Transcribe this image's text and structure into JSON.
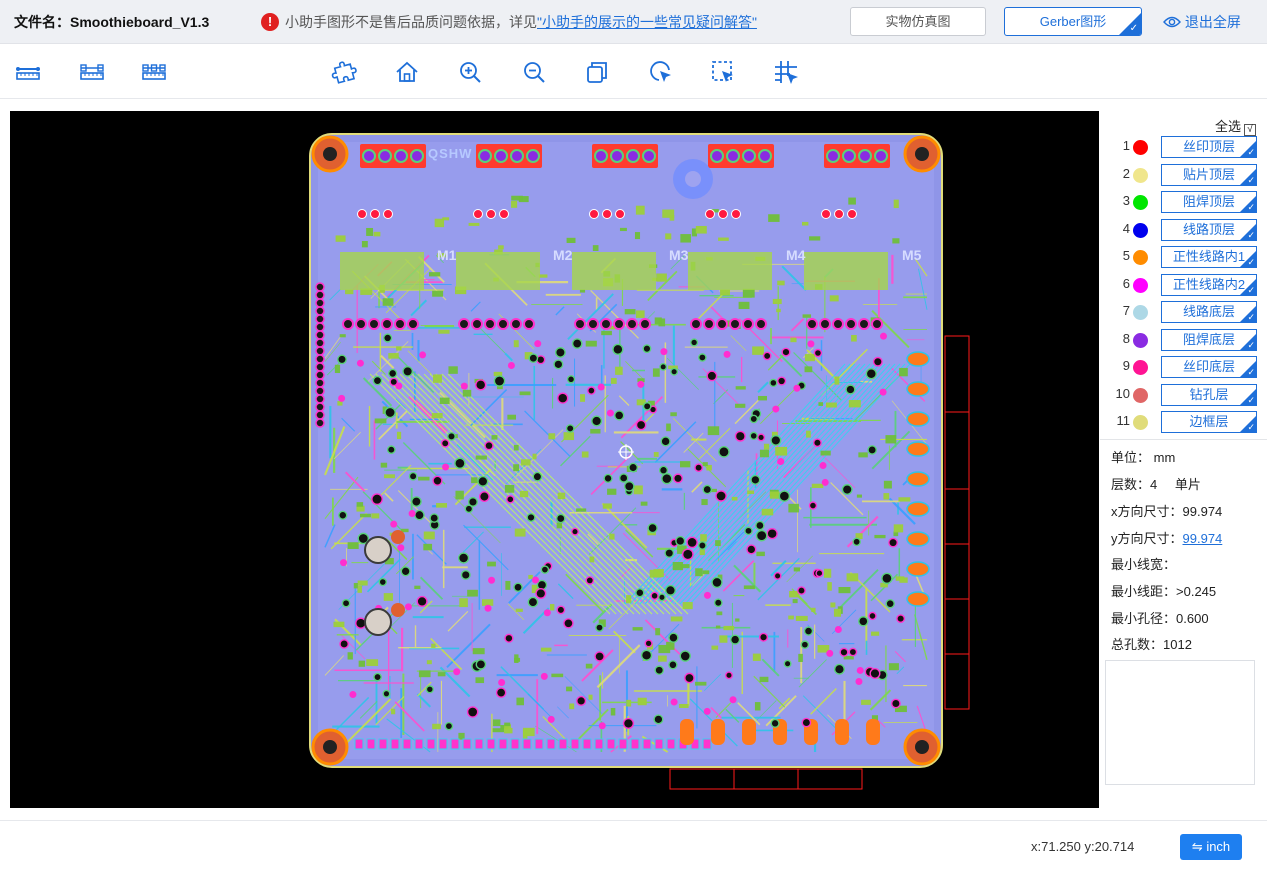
{
  "infobar": {
    "file_label": "文件名：Smoothieboard_V1.3",
    "notice_text": "小助手图形不是售后品质问题依据，详见",
    "notice_link": "\"小助手的展示的一些常见疑问解答\"",
    "sim_button": "实物仿真图",
    "gerber_button": "Gerber图形",
    "exit_fullscreen": "退出全屏"
  },
  "toolbar": {
    "icons": [
      "ruler-icon",
      "ruler-double-icon",
      "ruler-split-icon",
      "puzzle-icon",
      "home-icon",
      "zoom-in-icon",
      "zoom-out-icon",
      "copy-layers-icon",
      "pointer-click-icon",
      "select-area-icon",
      "grid-icon"
    ]
  },
  "layers": {
    "select_all": "全选",
    "items": [
      {
        "num": "1",
        "label": "丝印顶层",
        "color": "#ff0000"
      },
      {
        "num": "2",
        "label": "贴片顶层",
        "color": "#f0e68c"
      },
      {
        "num": "3",
        "label": "阻焊顶层",
        "color": "#00e600"
      },
      {
        "num": "4",
        "label": "线路顶层",
        "color": "#0000ee"
      },
      {
        "num": "5",
        "label": "正性线路内1",
        "color": "#ff8c00"
      },
      {
        "num": "6",
        "label": "正性线路内2",
        "color": "#ff00ff"
      },
      {
        "num": "7",
        "label": "线路底层",
        "color": "#add8e6"
      },
      {
        "num": "8",
        "label": "阻焊底层",
        "color": "#8a2be2"
      },
      {
        "num": "9",
        "label": "丝印底层",
        "color": "#ff1493"
      },
      {
        "num": "10",
        "label": "钻孔层",
        "color": "#e06666"
      },
      {
        "num": "11",
        "label": "边框层",
        "color": "#e0dc7a"
      }
    ]
  },
  "board_info": {
    "unit_label": "单位：",
    "unit_value": "mm",
    "layers_label": "层数：",
    "layers_value": "4",
    "layers_single": "单片",
    "x_label": "x方向尺寸：",
    "x_value": "99.974",
    "y_label": "y方向尺寸：",
    "y_value": "99.974",
    "min_width_label": "最小线宽：",
    "min_space_label": "最小线距：",
    "min_space_value": ">0.245",
    "min_hole_label": "最小孔径：",
    "min_hole_value": "0.600",
    "total_holes_label": "总孔数：",
    "total_holes_value": "1012"
  },
  "board_silk": {
    "logo": "QSHW",
    "motors": [
      "M1",
      "M2",
      "M3",
      "M4",
      "M5"
    ]
  },
  "status": {
    "coords": "x:71.250 y:20.714",
    "inch_button": "⇋ inch"
  }
}
